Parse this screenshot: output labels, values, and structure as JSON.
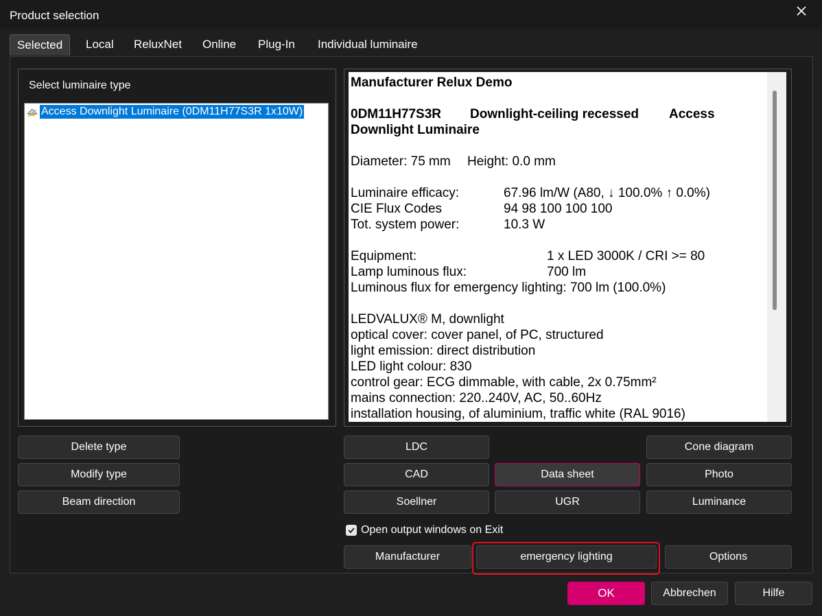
{
  "window": {
    "title": "Product selection"
  },
  "tabs": [
    {
      "label": "Selected",
      "active": true
    },
    {
      "label": "Local"
    },
    {
      "label": "ReluxNet"
    },
    {
      "label": "Online"
    },
    {
      "label": "Plug-In"
    },
    {
      "label": "Individual luminaire"
    }
  ],
  "left_panel": {
    "label": "Select luminaire type",
    "items": [
      {
        "label": "Access Downlight Luminaire (0DM11H77S3R 1x10W)",
        "selected": true
      }
    ]
  },
  "datasheet": {
    "manufacturer_line": "Manufacturer Relux Demo",
    "article": {
      "code": "0DM11H77S3R",
      "type": "Downlight-ceiling recessed",
      "name_part1": "Access",
      "name_part2": "Downlight Luminaire"
    },
    "dimensions": {
      "diameter": "Diameter: 75 mm",
      "height": "Height: 0.0 mm"
    },
    "rows_a": [
      {
        "label": "Luminaire efficacy:",
        "value": "67.96 lm/W (A80, ↓ 100.0% ↑ 0.0%)"
      },
      {
        "label": "CIE Flux Codes",
        "value": "94 98 100 100 100"
      },
      {
        "label": "Tot. system power:",
        "value": "10.3 W"
      }
    ],
    "rows_b": [
      {
        "label": "Equipment:",
        "value": "1 x LED 3000K / CRI >= 80"
      },
      {
        "label": "Lamp luminous flux:",
        "value": "700 lm"
      }
    ],
    "emergency_line": "Luminous flux for emergency lighting: 700 lm (100.0%)",
    "description": [
      "LEDVALUX® M, downlight",
      "optical cover: cover panel, of PC, structured",
      "light emission: direct distribution",
      "LED light colour: 830",
      "control gear: ECG dimmable, with cable, 2x 0.75mm²",
      "mains connection: 220..240V, AC, 50..60Hz",
      "installation housing, of aluminium, traffic white (RAL 9016)"
    ]
  },
  "buttons": {
    "delete_type": "Delete type",
    "modify_type": "Modify type",
    "beam_direction": "Beam direction",
    "ldc": "LDC",
    "cad": "CAD",
    "soellner": "Soellner",
    "data_sheet": "Data sheet",
    "ugr": "UGR",
    "cone_diagram": "Cone diagram",
    "photo": "Photo",
    "luminance": "Luminance",
    "manufacturer": "Manufacturer",
    "emergency_lighting": "emergency lighting",
    "options": "Options",
    "ok": "OK",
    "cancel": "Abbrechen",
    "help": "Hilfe"
  },
  "checkbox": {
    "label": "Open output windows on Exit",
    "checked": true
  },
  "colors": {
    "accent": "#d4006e",
    "highlight": "#e0101e",
    "selection": "#0078d7"
  }
}
